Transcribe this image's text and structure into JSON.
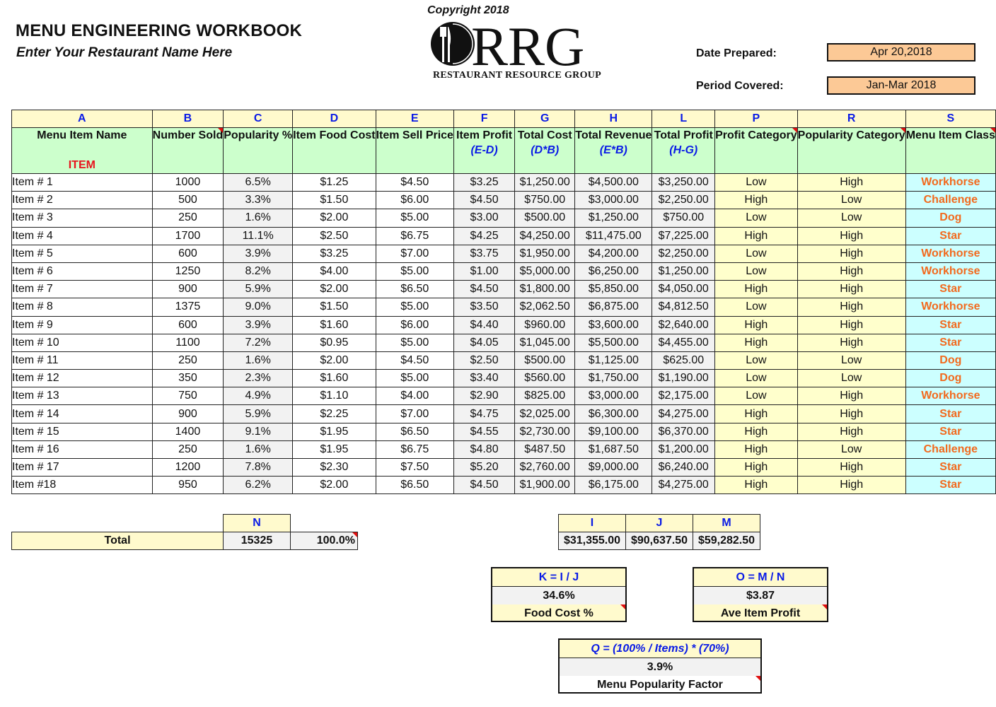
{
  "header": {
    "title": "MENU ENGINEERING WORKBOOK",
    "subtitle": "Enter Your Restaurant Name Here",
    "copyright": "Copyright 2018",
    "logo_letters": "RRG",
    "logo_company": "RESTAURANT RESOURCE GROUP",
    "date_prepared_label": "Date Prepared:",
    "date_prepared_value": "Apr 20,2018",
    "period_covered_label": "Period Covered:",
    "period_covered_value": "Jan-Mar 2018"
  },
  "columns": [
    {
      "letter": "A",
      "label": "Menu Item Name",
      "sub": "ITEM"
    },
    {
      "letter": "B",
      "label": "Number Sold",
      "sub": ""
    },
    {
      "letter": "C",
      "label": "Popularity %",
      "sub": ""
    },
    {
      "letter": "D",
      "label": "Item Food Cost",
      "sub": ""
    },
    {
      "letter": "E",
      "label": "Item Sell Price",
      "sub": ""
    },
    {
      "letter": "F",
      "label": "Item Profit",
      "sub": "(E-D)"
    },
    {
      "letter": "G",
      "label": "Total Cost",
      "sub": "(D*B)"
    },
    {
      "letter": "H",
      "label": "Total Revenue",
      "sub": "(E*B)"
    },
    {
      "letter": "L",
      "label": "Total Profit",
      "sub": "(H-G)"
    },
    {
      "letter": "P",
      "label": "Profit Category",
      "sub": ""
    },
    {
      "letter": "R",
      "label": "Popularity Category",
      "sub": ""
    },
    {
      "letter": "S",
      "label": "Menu Item Class",
      "sub": ""
    }
  ],
  "rows": [
    [
      "Item # 1",
      "1000",
      "6.5%",
      "$1.25",
      "$4.50",
      "$3.25",
      "$1,250.00",
      "$4,500.00",
      "$3,250.00",
      "Low",
      "High",
      "Workhorse"
    ],
    [
      "Item # 2",
      "500",
      "3.3%",
      "$1.50",
      "$6.00",
      "$4.50",
      "$750.00",
      "$3,000.00",
      "$2,250.00",
      "High",
      "Low",
      "Challenge"
    ],
    [
      "Item # 3",
      "250",
      "1.6%",
      "$2.00",
      "$5.00",
      "$3.00",
      "$500.00",
      "$1,250.00",
      "$750.00",
      "Low",
      "Low",
      "Dog"
    ],
    [
      "Item # 4",
      "1700",
      "11.1%",
      "$2.50",
      "$6.75",
      "$4.25",
      "$4,250.00",
      "$11,475.00",
      "$7,225.00",
      "High",
      "High",
      "Star"
    ],
    [
      "Item # 5",
      "600",
      "3.9%",
      "$3.25",
      "$7.00",
      "$3.75",
      "$1,950.00",
      "$4,200.00",
      "$2,250.00",
      "Low",
      "High",
      "Workhorse"
    ],
    [
      "Item # 6",
      "1250",
      "8.2%",
      "$4.00",
      "$5.00",
      "$1.00",
      "$5,000.00",
      "$6,250.00",
      "$1,250.00",
      "Low",
      "High",
      "Workhorse"
    ],
    [
      "Item # 7",
      "900",
      "5.9%",
      "$2.00",
      "$6.50",
      "$4.50",
      "$1,800.00",
      "$5,850.00",
      "$4,050.00",
      "High",
      "High",
      "Star"
    ],
    [
      "Item # 8",
      "1375",
      "9.0%",
      "$1.50",
      "$5.00",
      "$3.50",
      "$2,062.50",
      "$6,875.00",
      "$4,812.50",
      "Low",
      "High",
      "Workhorse"
    ],
    [
      "Item # 9",
      "600",
      "3.9%",
      "$1.60",
      "$6.00",
      "$4.40",
      "$960.00",
      "$3,600.00",
      "$2,640.00",
      "High",
      "High",
      "Star"
    ],
    [
      "Item # 10",
      "1100",
      "7.2%",
      "$0.95",
      "$5.00",
      "$4.05",
      "$1,045.00",
      "$5,500.00",
      "$4,455.00",
      "High",
      "High",
      "Star"
    ],
    [
      "Item # 11",
      "250",
      "1.6%",
      "$2.00",
      "$4.50",
      "$2.50",
      "$500.00",
      "$1,125.00",
      "$625.00",
      "Low",
      "Low",
      "Dog"
    ],
    [
      "Item # 12",
      "350",
      "2.3%",
      "$1.60",
      "$5.00",
      "$3.40",
      "$560.00",
      "$1,750.00",
      "$1,190.00",
      "Low",
      "Low",
      "Dog"
    ],
    [
      "Item # 13",
      "750",
      "4.9%",
      "$1.10",
      "$4.00",
      "$2.90",
      "$825.00",
      "$3,000.00",
      "$2,175.00",
      "Low",
      "High",
      "Workhorse"
    ],
    [
      "Item # 14",
      "900",
      "5.9%",
      "$2.25",
      "$7.00",
      "$4.75",
      "$2,025.00",
      "$6,300.00",
      "$4,275.00",
      "High",
      "High",
      "Star"
    ],
    [
      "Item # 15",
      "1400",
      "9.1%",
      "$1.95",
      "$6.50",
      "$4.55",
      "$2,730.00",
      "$9,100.00",
      "$6,370.00",
      "High",
      "High",
      "Star"
    ],
    [
      "Item # 16",
      "250",
      "1.6%",
      "$1.95",
      "$6.75",
      "$4.80",
      "$487.50",
      "$1,687.50",
      "$1,200.00",
      "High",
      "Low",
      "Challenge"
    ],
    [
      "Item # 17",
      "1200",
      "7.8%",
      "$2.30",
      "$7.50",
      "$5.20",
      "$2,760.00",
      "$9,000.00",
      "$6,240.00",
      "High",
      "High",
      "Star"
    ],
    [
      "Item #18",
      "950",
      "6.2%",
      "$2.00",
      "$6.50",
      "$4.50",
      "$1,900.00",
      "$6,175.00",
      "$4,275.00",
      "High",
      "High",
      "Star"
    ]
  ],
  "totals": {
    "label": "Total",
    "n_letter": "N",
    "n_value": "15325",
    "pct_value": "100.0%",
    "i_letter": "I",
    "i_value": "$31,355.00",
    "j_letter": "J",
    "j_value": "$90,637.50",
    "m_letter": "M",
    "m_value": "$59,282.50"
  },
  "metrics": {
    "food_cost": {
      "formula": "K = I / J",
      "value": "34.6%",
      "label": "Food Cost %"
    },
    "ave_profit": {
      "formula": "O = M / N",
      "value": "$3.87",
      "label": "Ave Item Profit"
    },
    "popularity_factor": {
      "formula": "Q = (100% / Items) * (70%)",
      "value": "3.9%",
      "label": "Menu Popularity Factor"
    }
  }
}
